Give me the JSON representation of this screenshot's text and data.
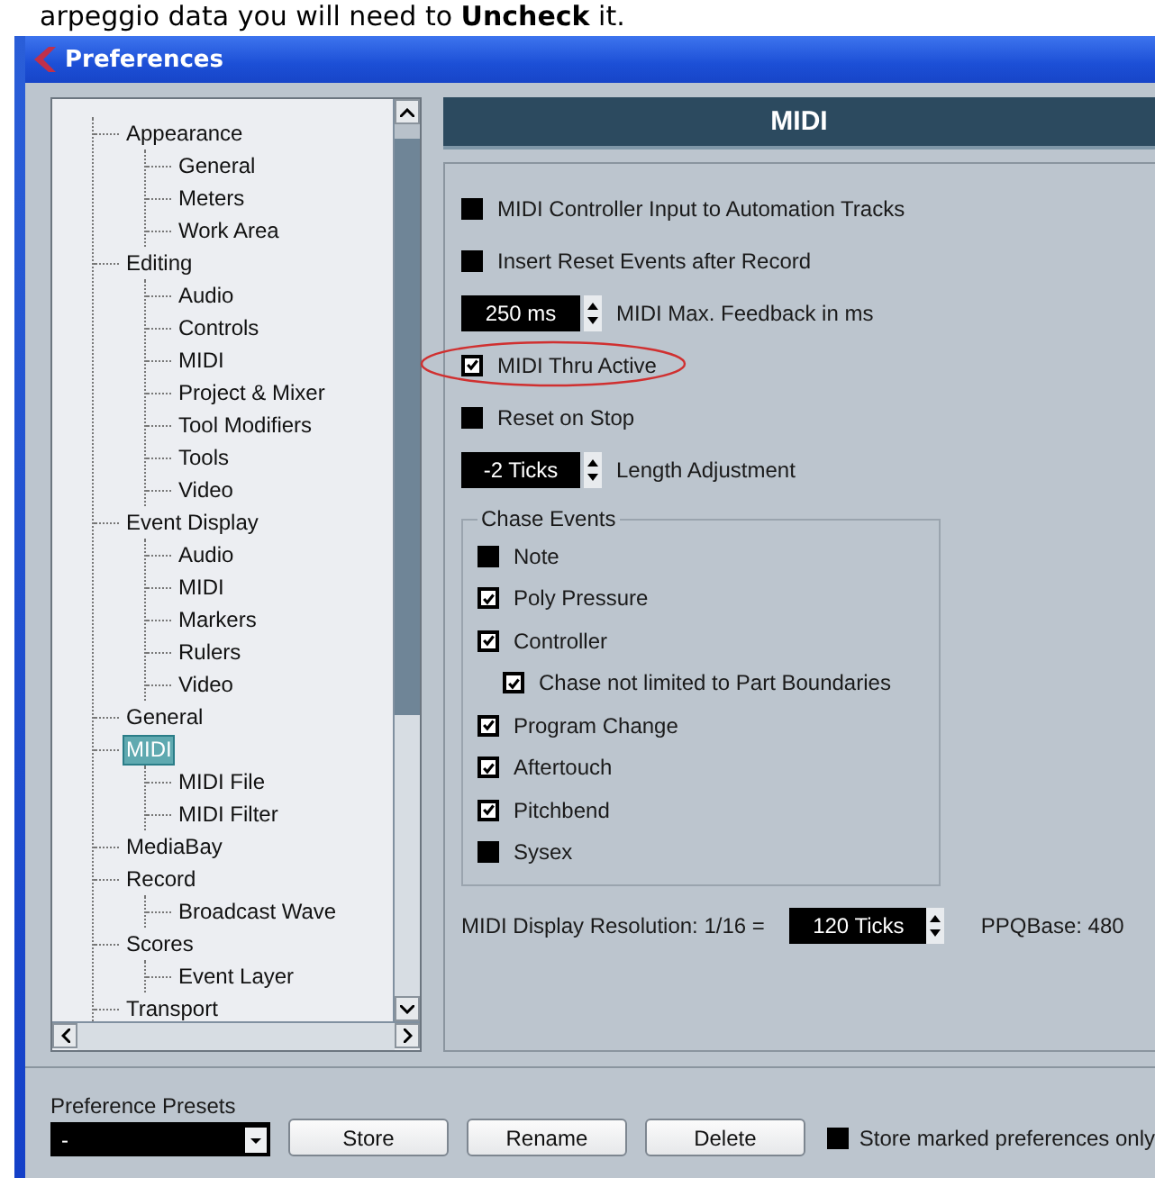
{
  "caption": "arpeggio data you will need to **Uncheck** it.",
  "window": {
    "title": "Preferences"
  },
  "tree": {
    "items": [
      {
        "label": "Appearance",
        "selected": false,
        "children": [
          {
            "label": "General",
            "selected": false
          },
          {
            "label": "Meters",
            "selected": false
          },
          {
            "label": "Work Area",
            "selected": false
          }
        ]
      },
      {
        "label": "Editing",
        "selected": false,
        "children": [
          {
            "label": "Audio",
            "selected": false
          },
          {
            "label": "Controls",
            "selected": false
          },
          {
            "label": "MIDI",
            "selected": false
          },
          {
            "label": "Project & Mixer",
            "selected": false
          },
          {
            "label": "Tool Modifiers",
            "selected": false
          },
          {
            "label": "Tools",
            "selected": false
          },
          {
            "label": "Video",
            "selected": false
          }
        ]
      },
      {
        "label": "Event Display",
        "selected": false,
        "children": [
          {
            "label": "Audio",
            "selected": false
          },
          {
            "label": "MIDI",
            "selected": false
          },
          {
            "label": "Markers",
            "selected": false
          },
          {
            "label": "Rulers",
            "selected": false
          },
          {
            "label": "Video",
            "selected": false
          }
        ]
      },
      {
        "label": "General",
        "selected": false
      },
      {
        "label": "MIDI",
        "selected": true,
        "children": [
          {
            "label": "MIDI File",
            "selected": false
          },
          {
            "label": "MIDI Filter",
            "selected": false
          }
        ]
      },
      {
        "label": "MediaBay",
        "selected": false
      },
      {
        "label": "Record",
        "selected": false,
        "children": [
          {
            "label": "Broadcast Wave",
            "selected": false
          }
        ]
      },
      {
        "label": "Scores",
        "selected": false,
        "children": [
          {
            "label": "Event Layer",
            "selected": false
          }
        ]
      },
      {
        "label": "Transport",
        "selected": false
      }
    ]
  },
  "panel": {
    "title": "MIDI",
    "options": [
      {
        "kind": "checkbox",
        "label": "MIDI Controller Input to Automation Tracks",
        "checked": false,
        "circled": false
      },
      {
        "kind": "checkbox",
        "label": "Insert Reset Events after Record",
        "checked": false,
        "circled": false
      },
      {
        "kind": "spinner",
        "value": "250 ms",
        "label": "MIDI Max. Feedback in ms",
        "circled": false
      },
      {
        "kind": "checkbox",
        "label": "MIDI Thru Active",
        "checked": true,
        "circled": true
      },
      {
        "kind": "checkbox",
        "label": "Reset on Stop",
        "checked": false,
        "circled": false
      },
      {
        "kind": "spinner",
        "value": "-2 Ticks",
        "label": "Length Adjustment",
        "circled": false
      }
    ],
    "chase_events": {
      "title": "Chase Events",
      "items": [
        {
          "label": "Note",
          "checked": false
        },
        {
          "label": "Poly Pressure",
          "checked": true
        },
        {
          "label": "Controller",
          "checked": true,
          "children": [
            {
              "label": "Chase not limited to Part Boundaries",
              "checked": true
            }
          ]
        },
        {
          "label": "Program Change",
          "checked": true
        },
        {
          "label": "Aftertouch",
          "checked": true
        },
        {
          "label": "Pitchbend",
          "checked": true
        },
        {
          "label": "Sysex",
          "checked": false
        }
      ]
    },
    "resolution": {
      "label": "MIDI Display Resolution: 1/16 =",
      "value": "120 Ticks",
      "ppq": "PPQBase: 480"
    }
  },
  "presets": {
    "label": "Preference Presets",
    "value": "-",
    "buttons": [
      "Store",
      "Rename",
      "Delete"
    ],
    "store_marked": {
      "label": "Store marked preferences only",
      "checked": false
    }
  }
}
